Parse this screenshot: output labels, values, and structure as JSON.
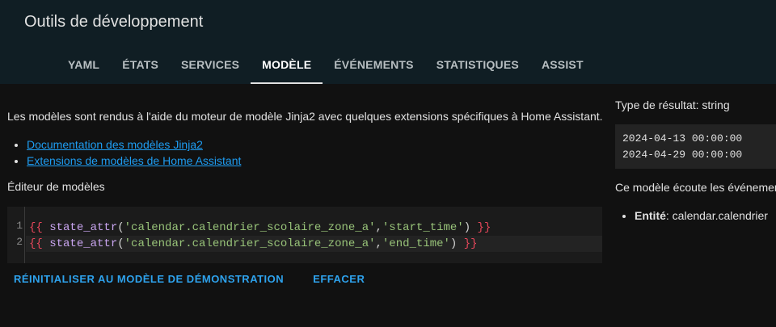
{
  "header": {
    "title": "Outils de développement",
    "tabs": [
      {
        "label": "YAML"
      },
      {
        "label": "ÉTATS"
      },
      {
        "label": "SERVICES"
      },
      {
        "label": "MODÈLE",
        "active": true
      },
      {
        "label": "ÉVÉNEMENTS"
      },
      {
        "label": "STATISTIQUES"
      },
      {
        "label": "ASSIST"
      }
    ]
  },
  "main": {
    "intro": "Les modèles sont rendus à l'aide du moteur de modèle Jinja2 avec quelques extensions spécifiques à Home Assistant.",
    "links": [
      {
        "label": "Documentation des modèles Jinja2"
      },
      {
        "label": "Extensions de modèles de Home Assistant"
      }
    ],
    "editor_heading": "Éditeur de modèles",
    "editor": {
      "lines": [
        {
          "number": "1",
          "open": "{{",
          "fn": "state_attr",
          "lparen": "(",
          "arg1": "'calendar.calendrier_scolaire_zone_a'",
          "comma": ",",
          "arg2": "'start_time'",
          "rparen": ")",
          "close": "}}"
        },
        {
          "number": "2",
          "open": "{{",
          "fn": "state_attr",
          "lparen": "(",
          "arg1": "'calendar.calendrier_scolaire_zone_a'",
          "comma": ",",
          "arg2": "'end_time'",
          "rparen": ")",
          "close": "}}"
        }
      ]
    },
    "actions": {
      "reset_label": "RÉINITIALISER AU MODÈLE DE DÉMONSTRATION",
      "clear_label": "EFFACER"
    }
  },
  "sidebar": {
    "result_type": "Type de résultat: string",
    "result_lines": [
      "2024-04-13 00:00:00",
      "2024-04-29 00:00:00"
    ],
    "listens_text": "Ce modèle écoute les événemer",
    "entity_label": "Entité",
    "entity_value": ": calendar.calendrier"
  },
  "colors": {
    "header_bg": "#101e24",
    "page_bg": "#111111",
    "link": "#1e9df2",
    "accent_button": "#2ea3ee"
  }
}
